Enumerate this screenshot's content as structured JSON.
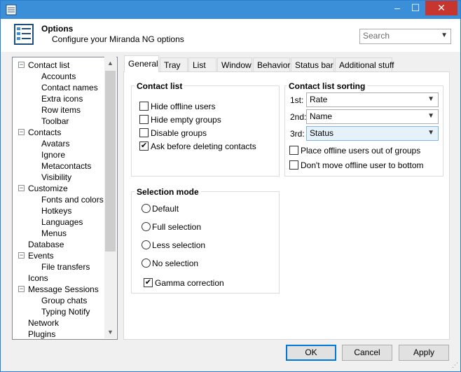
{
  "header": {
    "title": "Options",
    "subtitle": "Configure your Miranda NG options",
    "search_placeholder": "Search"
  },
  "window_controls": {
    "minimize": "–",
    "maximize": "☐",
    "close": "✕"
  },
  "tree": {
    "items": [
      {
        "label": "Contact list",
        "level": 0,
        "expandable": true
      },
      {
        "label": "Accounts",
        "level": 1
      },
      {
        "label": "Contact names",
        "level": 1
      },
      {
        "label": "Extra icons",
        "level": 1
      },
      {
        "label": "Row items",
        "level": 1
      },
      {
        "label": "Toolbar",
        "level": 1
      },
      {
        "label": "Contacts",
        "level": 0,
        "expandable": true
      },
      {
        "label": "Avatars",
        "level": 1
      },
      {
        "label": "Ignore",
        "level": 1
      },
      {
        "label": "Metacontacts",
        "level": 1
      },
      {
        "label": "Visibility",
        "level": 1
      },
      {
        "label": "Customize",
        "level": 0,
        "expandable": true
      },
      {
        "label": "Fonts and colors",
        "level": 1
      },
      {
        "label": "Hotkeys",
        "level": 1
      },
      {
        "label": "Languages",
        "level": 1
      },
      {
        "label": "Menus",
        "level": 1
      },
      {
        "label": "Database",
        "level": 0
      },
      {
        "label": "Events",
        "level": 0,
        "expandable": true
      },
      {
        "label": "File transfers",
        "level": 1
      },
      {
        "label": "Icons",
        "level": 0
      },
      {
        "label": "Message Sessions",
        "level": 0,
        "expandable": true
      },
      {
        "label": "Group chats",
        "level": 1
      },
      {
        "label": "Typing Notify",
        "level": 1
      },
      {
        "label": "Network",
        "level": 0
      },
      {
        "label": "Plugins",
        "level": 0
      }
    ]
  },
  "tabs": [
    "General",
    "Tray",
    "List",
    "Window",
    "Behavior",
    "Status bar",
    "Additional stuff"
  ],
  "active_tab": "General",
  "contact_list": {
    "title": "Contact list",
    "options": [
      {
        "label": "Hide offline users",
        "checked": false
      },
      {
        "label": "Hide empty groups",
        "checked": false
      },
      {
        "label": "Disable groups",
        "checked": false
      },
      {
        "label": "Ask before deleting contacts",
        "checked": true
      }
    ]
  },
  "sorting": {
    "title": "Contact list sorting",
    "rows": [
      {
        "label": "1st:",
        "value": "Rate"
      },
      {
        "label": "2nd:",
        "value": "Name"
      },
      {
        "label": "3rd:",
        "value": "Status"
      }
    ],
    "options": [
      {
        "label": "Place offline users out of groups",
        "checked": false
      },
      {
        "label": "Don't move offline user to bottom",
        "checked": false
      }
    ]
  },
  "selection_mode": {
    "title": "Selection mode",
    "options": [
      {
        "label": "Default",
        "selected": false
      },
      {
        "label": "Full selection",
        "selected": false
      },
      {
        "label": "Less selection",
        "selected": false
      },
      {
        "label": "No selection",
        "selected": false
      }
    ],
    "gamma": {
      "label": "Gamma correction",
      "checked": true
    }
  },
  "buttons": {
    "ok": "OK",
    "cancel": "Cancel",
    "apply": "Apply"
  },
  "colors": {
    "titlebar": "#3b8fd9",
    "close": "#c7352f",
    "accent": "#0078d7"
  }
}
